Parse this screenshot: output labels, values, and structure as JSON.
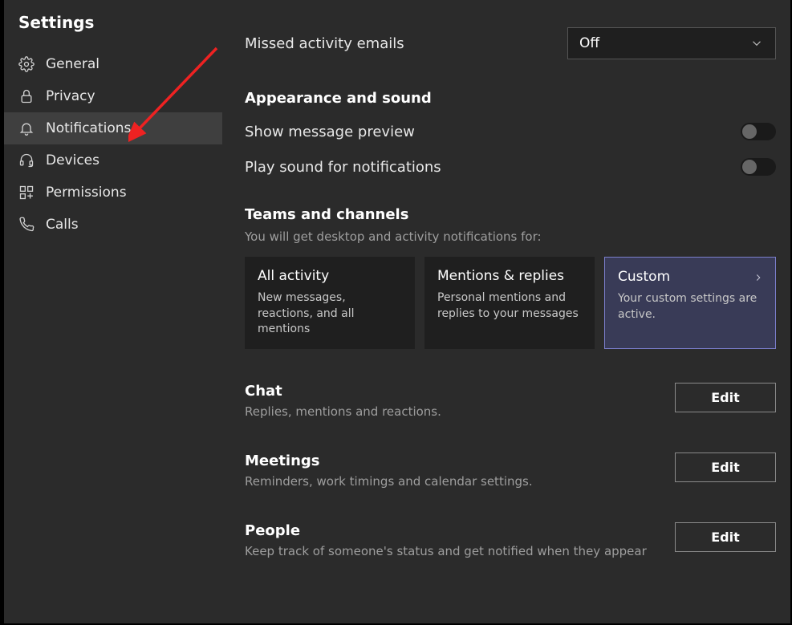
{
  "header": {
    "title": "Settings"
  },
  "sidebar": {
    "items": [
      {
        "label": "General",
        "icon": "gear-icon"
      },
      {
        "label": "Privacy",
        "icon": "lock-icon"
      },
      {
        "label": "Notifications",
        "icon": "bell-icon"
      },
      {
        "label": "Devices",
        "icon": "headset-icon"
      },
      {
        "label": "Permissions",
        "icon": "grid-icon"
      },
      {
        "label": "Calls",
        "icon": "phone-icon"
      }
    ],
    "active_index": 2
  },
  "main": {
    "missed_emails": {
      "label": "Missed activity emails",
      "value": "Off"
    },
    "appearance": {
      "title": "Appearance and sound",
      "message_preview": {
        "label": "Show message preview",
        "on": false
      },
      "play_sound": {
        "label": "Play sound for notifications",
        "on": false
      }
    },
    "teams": {
      "title": "Teams and channels",
      "subtitle": "You will get desktop and activity notifications for:",
      "options": [
        {
          "title": "All activity",
          "desc": "New messages, reactions, and all mentions"
        },
        {
          "title": "Mentions & replies",
          "desc": "Personal mentions and replies to your messages"
        },
        {
          "title": "Custom",
          "desc": "Your custom settings are active."
        }
      ],
      "selected_index": 2
    },
    "sections": [
      {
        "title": "Chat",
        "desc": "Replies, mentions and reactions.",
        "button": "Edit"
      },
      {
        "title": "Meetings",
        "desc": "Reminders, work timings and calendar settings.",
        "button": "Edit"
      },
      {
        "title": "People",
        "desc": "Keep track of someone's status and get notified when they appear",
        "button": "Edit"
      }
    ]
  }
}
